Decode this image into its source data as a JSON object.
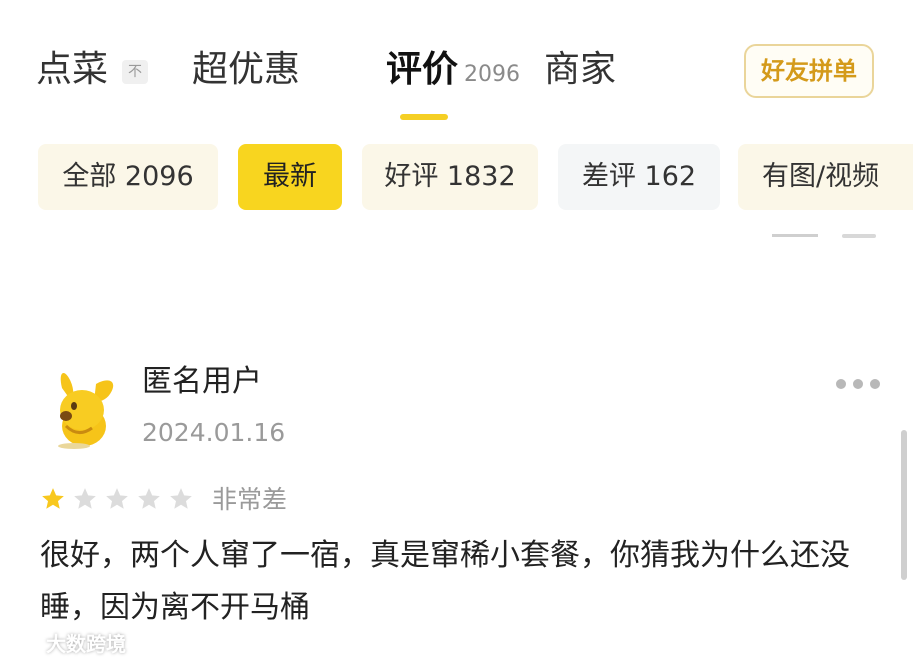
{
  "tabs": [
    {
      "label": "点菜",
      "badge": "不"
    },
    {
      "label": "超优惠"
    },
    {
      "label": "评价",
      "count": "2096"
    },
    {
      "label": "商家"
    }
  ],
  "group_order_label": "好友拼单",
  "filters": [
    {
      "label": "全部 2096"
    },
    {
      "label": "最新"
    },
    {
      "label": "好评 1832"
    },
    {
      "label": "差评 162"
    },
    {
      "label": "有图/视频"
    }
  ],
  "review": {
    "user_name": "匿名用户",
    "date": "2024.01.16",
    "rating": 1,
    "rating_max": 5,
    "rating_label": "非常差",
    "content": "很好，两个人窜了一宿，真是窜稀小套餐，你猜我为什么还没睡，因为离不开马桶"
  },
  "watermark": "大数跨境",
  "colors": {
    "accent": "#f8d51f",
    "chip_bg": "#fbf7e8",
    "star_on": "#f8c81e",
    "star_off": "#dcdcdc",
    "muted_text": "#9a9a9a"
  }
}
